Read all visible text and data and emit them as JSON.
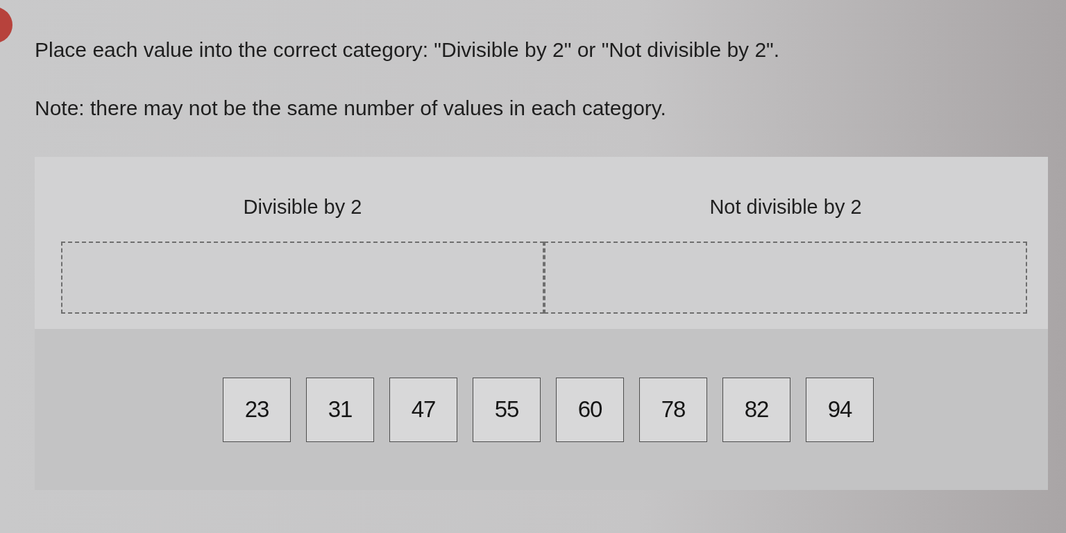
{
  "instructions": [
    "Place each value into the correct category: \"Divisible by 2\" or \"Not divisible by 2\".",
    "Note: there may not be the same number of values in each category."
  ],
  "categories": [
    {
      "title": "Divisible by 2"
    },
    {
      "title": "Not divisible by 2"
    }
  ],
  "values": [
    "23",
    "31",
    "47",
    "55",
    "60",
    "78",
    "82",
    "94"
  ]
}
